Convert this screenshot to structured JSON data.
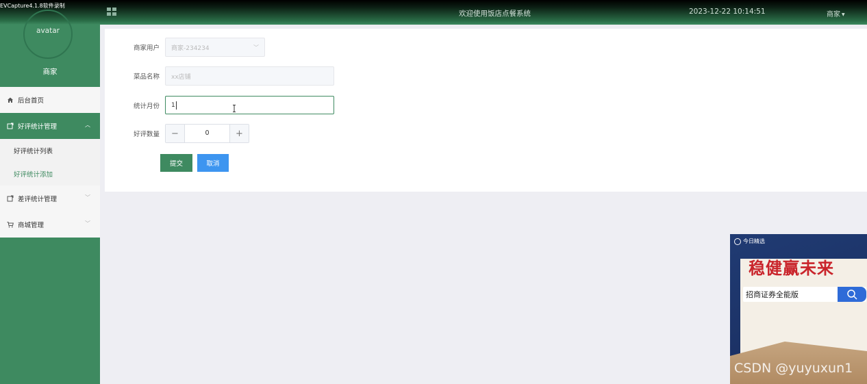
{
  "recorder": {
    "label": "EVCapture4.1.8软件录制"
  },
  "header": {
    "title": "欢迎使用饭店点餐系统",
    "datetime": "2023-12-22 10:14:51",
    "user_label": "商家"
  },
  "sidebar": {
    "avatar_alt": "avatar",
    "role": "商家",
    "items": [
      {
        "label": "后台首页"
      },
      {
        "label": "好评统计管理",
        "expanded": true,
        "children": [
          {
            "label": "好评统计列表"
          },
          {
            "label": "好评统计添加"
          }
        ]
      },
      {
        "label": "差评统计管理"
      },
      {
        "label": "商城管理"
      }
    ]
  },
  "form": {
    "merchant_user": {
      "label": "商家用户",
      "value": "商家-234234"
    },
    "dish_name": {
      "label": "菜品名称",
      "placeholder": "xx店铺"
    },
    "stat_month": {
      "label": "统计月份",
      "value": "1"
    },
    "good_count": {
      "label": "好评数量",
      "value": "0",
      "minus": "−",
      "plus": "+"
    },
    "submit_label": "提交",
    "cancel_label": "取消"
  },
  "ad": {
    "badge": "今日精选",
    "headline": "稳健赢未来",
    "query": "招商证券全能版"
  },
  "watermark": "CSDN @yuyuxun1",
  "colors": {
    "brand_green": "#3e8a60",
    "cancel_blue": "#3d95f0"
  }
}
